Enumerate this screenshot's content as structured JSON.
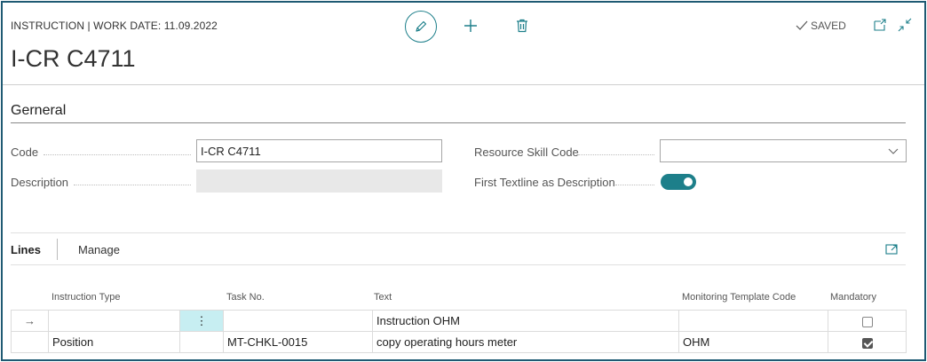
{
  "header": {
    "caption": "INSTRUCTION | WORK DATE: 11.09.2022",
    "title": "I-CR C4711",
    "saved_label": "SAVED",
    "icons": [
      "edit-icon",
      "plus-icon",
      "delete-icon",
      "check-icon",
      "open-new-window-icon",
      "collapse-icon"
    ]
  },
  "general": {
    "section_title": "Gerneral",
    "code_label": "Code",
    "code_value": "I-CR C4711",
    "description_label": "Description",
    "resource_skill_label": "Resource Skill Code",
    "resource_skill_value": "",
    "first_textline_label": "First Textline as Description",
    "first_textline_on": true
  },
  "lines": {
    "tab_lines": "Lines",
    "tab_manage": "Manage",
    "columns": [
      "Instruction Type",
      "Task No.",
      "Text",
      "Monitoring Template Code",
      "Mandatory"
    ],
    "rows": [
      {
        "marker": "→",
        "instruction_type": "",
        "menu": "⋮",
        "task_no": "",
        "text": "Instruction OHM",
        "template": "",
        "mandatory": false
      },
      {
        "marker": "",
        "instruction_type": "Position",
        "menu": "",
        "task_no": "MT-CHKL-0015",
        "text": "copy operating hours meter",
        "template": "OHM",
        "mandatory": true
      }
    ]
  },
  "colors": {
    "accent": "#1d7f8a",
    "frame": "#1f5a73",
    "row_highlight": "#c7eef2"
  }
}
